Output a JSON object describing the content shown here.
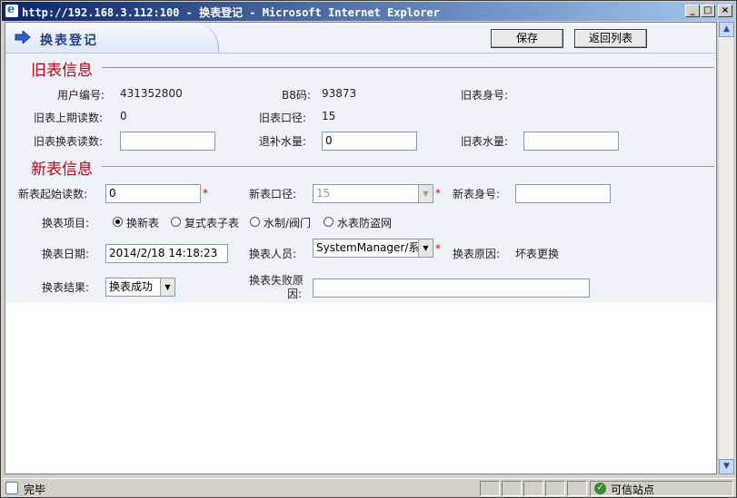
{
  "window": {
    "title": "http://192.168.3.112:100 - 换表登记 - Microsoft Internet Explorer"
  },
  "header": {
    "title": "换表登记",
    "save_label": "保存",
    "back_label": "返回列表"
  },
  "old_section": {
    "title": "旧表信息",
    "user_no_label": "用户编号:",
    "user_no": "431352800",
    "b8_label": "B8码:",
    "b8": "93873",
    "old_id_label": "旧表身号:",
    "last_reading_label": "旧表上期读数:",
    "last_reading": "0",
    "old_caliber_label": "旧表口径:",
    "old_caliber": "15",
    "swap_reading_label": "旧表换表读数:",
    "swap_reading": "",
    "refund_label": "退补水量:",
    "refund": "0",
    "old_water_label": "旧表水量:",
    "old_water": ""
  },
  "new_section": {
    "title": "新表信息",
    "start_reading_label": "新表起始读数:",
    "start_reading": "0",
    "new_caliber_label": "新表口径:",
    "new_caliber": "15",
    "new_id_label": "新表身号:",
    "new_id": "",
    "items_label": "换表项目:",
    "items": [
      "换新表",
      "复式表子表",
      "水制/阀门",
      "水表防盗网"
    ],
    "date_label": "换表日期:",
    "date": "2014/2/18 14:18:23",
    "person_label": "换表人员:",
    "person": "SystemManager/系",
    "reason_label": "换表原因:",
    "reason": "坏表更换",
    "result_label": "换表结果:",
    "result": "换表成功",
    "fail_label_1": "换表失败原",
    "fail_label_2": "因:",
    "fail": ""
  },
  "status": {
    "text": "完毕",
    "zone": "可信站点"
  },
  "colors": {
    "section_title": "#c0000a",
    "title_bar_start": "#0a246a",
    "page_title": "#23408e"
  }
}
